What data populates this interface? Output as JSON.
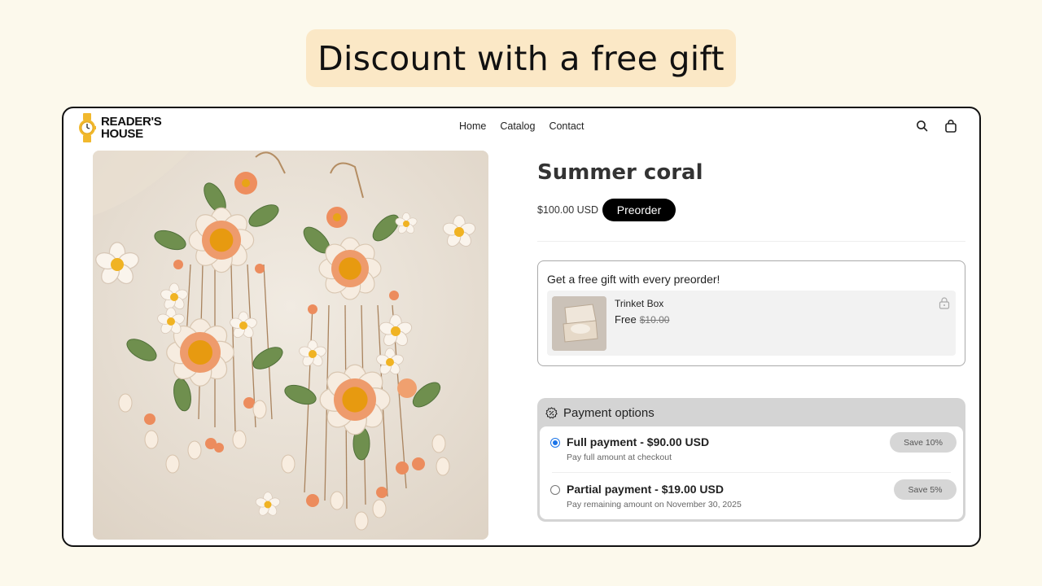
{
  "banner": {
    "text": "Discount with a free gift"
  },
  "header": {
    "brand_line1": "READER'S",
    "brand_line2": "HOUSE",
    "nav": [
      "Home",
      "Catalog",
      "Contact"
    ],
    "icons": {
      "search": "search-icon",
      "cart": "shopping-bag-icon",
      "logo": "watch-icon"
    }
  },
  "product": {
    "title": "Summer coral",
    "price": "$100.00 USD",
    "preorder_label": "Preorder",
    "image": "crochet-flower-earrings-image"
  },
  "gift": {
    "heading": "Get a free gift with every preorder!",
    "item_name": "Trinket Box",
    "free_label": "Free",
    "original_price": "$10.00",
    "icon": "lock-icon"
  },
  "payment": {
    "heading": "Payment options",
    "icon": "percent-badge-icon",
    "options": [
      {
        "title": "Full payment - $90.00 USD",
        "subtitle": "Pay full amount at checkout",
        "badge": "Save 10%",
        "selected": true
      },
      {
        "title": "Partial payment - $19.00 USD",
        "subtitle": "Pay remaining amount on November 30, 2025",
        "badge": "Save 5%",
        "selected": false
      }
    ]
  },
  "colors": {
    "page_bg": "#fcf9ec",
    "banner_bg": "#fbe8c6",
    "radio_blue": "#1a73e8",
    "logo_gold": "#f1b82d"
  }
}
